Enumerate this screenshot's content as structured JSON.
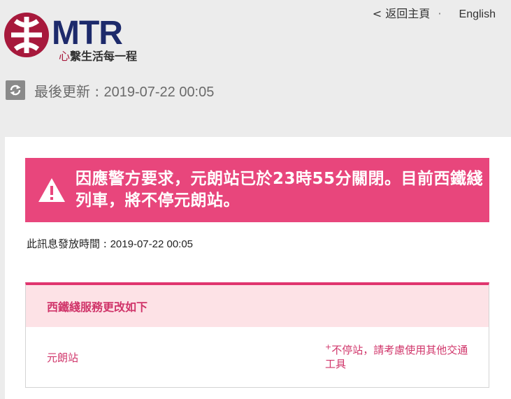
{
  "header": {
    "logo_text": "MTR",
    "slogan_heart": "心",
    "slogan_rest": "繫生活每一程",
    "back_link": "< 返回主頁",
    "separator": "·",
    "language_link": "English",
    "updated_label": "最後更新 : ",
    "updated_value": "2019-07-22 00:05"
  },
  "alert": {
    "message": "因應警方要求，元朗站已於23時55分關閉。目前西鐵綫列車，將不停元朗站。",
    "issued_label": "此訊息發放時間 : ",
    "issued_value": "2019-07-22 00:05"
  },
  "service": {
    "title": "西鐵綫服務更改如下",
    "rows": [
      {
        "station": "元朗站",
        "note_mark": "+",
        "note": "不停站，請考慮使用其他交通工具"
      }
    ]
  },
  "colors": {
    "brand_red": "#a7193c",
    "brand_navy": "#1d2a6b",
    "alert_pink": "#e8467c",
    "accent_pink": "#d0356a",
    "header_bg": "#ececec"
  },
  "icons": {
    "logo": "mtr-logo-icon",
    "refresh": "refresh-icon",
    "warning": "warning-triangle-icon"
  }
}
